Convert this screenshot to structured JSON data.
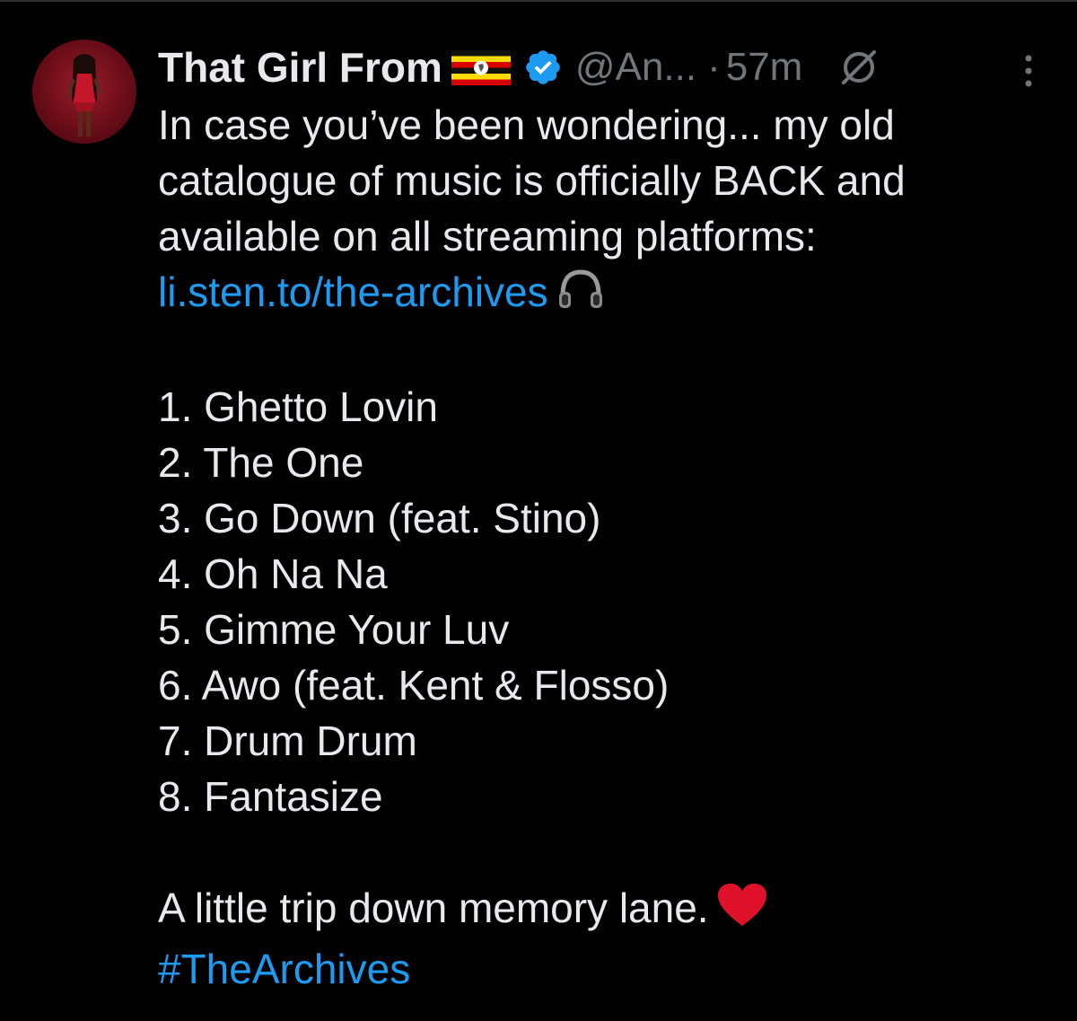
{
  "tweet": {
    "author": {
      "display_name": "That Girl From",
      "flag_icon": "uganda-flag-icon",
      "verified_icon": "verified-badge-icon",
      "handle": "@An...",
      "separator": "·",
      "time": "57m"
    },
    "text_lines": [
      "In case you’ve been wondering... my old",
      "catalogue of music is officially BACK and",
      "available on all streaming platforms:"
    ],
    "link": "li.sten.to/the-archives",
    "link_emoji": "headphones-icon",
    "tracklist": [
      "1. Ghetto Lovin",
      "2. The One",
      "3. Go Down (feat. Stino)",
      "4. Oh Na Na",
      "5. Gimme Your Luv",
      "6. Awo (feat. Kent & Flosso)",
      "7. Drum Drum",
      "8. Fantasize"
    ],
    "closing": "A little trip down memory lane.",
    "closing_emoji": "red-heart-icon",
    "hashtag": "#TheArchives"
  },
  "colors": {
    "background": "#000000",
    "text": "#e7e9ea",
    "muted": "#71767b",
    "link": "#1d9bf0",
    "verified": "#1d9bf0",
    "heart": "#e0112b"
  }
}
